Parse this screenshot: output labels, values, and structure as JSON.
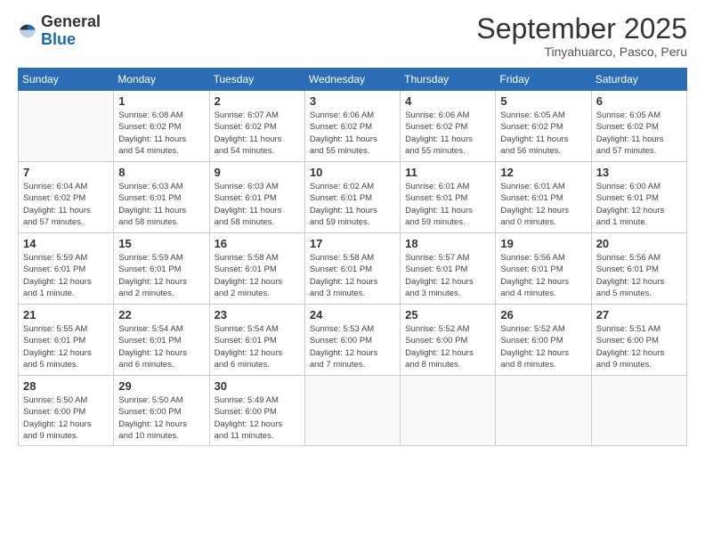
{
  "logo": {
    "general": "General",
    "blue": "Blue"
  },
  "header": {
    "month": "September 2025",
    "location": "Tinyahuarco, Pasco, Peru"
  },
  "days_of_week": [
    "Sunday",
    "Monday",
    "Tuesday",
    "Wednesday",
    "Thursday",
    "Friday",
    "Saturday"
  ],
  "weeks": [
    [
      {
        "day": "",
        "info": ""
      },
      {
        "day": "1",
        "info": "Sunrise: 6:08 AM\nSunset: 6:02 PM\nDaylight: 11 hours\nand 54 minutes."
      },
      {
        "day": "2",
        "info": "Sunrise: 6:07 AM\nSunset: 6:02 PM\nDaylight: 11 hours\nand 54 minutes."
      },
      {
        "day": "3",
        "info": "Sunrise: 6:06 AM\nSunset: 6:02 PM\nDaylight: 11 hours\nand 55 minutes."
      },
      {
        "day": "4",
        "info": "Sunrise: 6:06 AM\nSunset: 6:02 PM\nDaylight: 11 hours\nand 55 minutes."
      },
      {
        "day": "5",
        "info": "Sunrise: 6:05 AM\nSunset: 6:02 PM\nDaylight: 11 hours\nand 56 minutes."
      },
      {
        "day": "6",
        "info": "Sunrise: 6:05 AM\nSunset: 6:02 PM\nDaylight: 11 hours\nand 57 minutes."
      }
    ],
    [
      {
        "day": "7",
        "info": "Sunrise: 6:04 AM\nSunset: 6:02 PM\nDaylight: 11 hours\nand 57 minutes."
      },
      {
        "day": "8",
        "info": "Sunrise: 6:03 AM\nSunset: 6:01 PM\nDaylight: 11 hours\nand 58 minutes."
      },
      {
        "day": "9",
        "info": "Sunrise: 6:03 AM\nSunset: 6:01 PM\nDaylight: 11 hours\nand 58 minutes."
      },
      {
        "day": "10",
        "info": "Sunrise: 6:02 AM\nSunset: 6:01 PM\nDaylight: 11 hours\nand 59 minutes."
      },
      {
        "day": "11",
        "info": "Sunrise: 6:01 AM\nSunset: 6:01 PM\nDaylight: 11 hours\nand 59 minutes."
      },
      {
        "day": "12",
        "info": "Sunrise: 6:01 AM\nSunset: 6:01 PM\nDaylight: 12 hours\nand 0 minutes."
      },
      {
        "day": "13",
        "info": "Sunrise: 6:00 AM\nSunset: 6:01 PM\nDaylight: 12 hours\nand 1 minute."
      }
    ],
    [
      {
        "day": "14",
        "info": "Sunrise: 5:59 AM\nSunset: 6:01 PM\nDaylight: 12 hours\nand 1 minute."
      },
      {
        "day": "15",
        "info": "Sunrise: 5:59 AM\nSunset: 6:01 PM\nDaylight: 12 hours\nand 2 minutes."
      },
      {
        "day": "16",
        "info": "Sunrise: 5:58 AM\nSunset: 6:01 PM\nDaylight: 12 hours\nand 2 minutes."
      },
      {
        "day": "17",
        "info": "Sunrise: 5:58 AM\nSunset: 6:01 PM\nDaylight: 12 hours\nand 3 minutes."
      },
      {
        "day": "18",
        "info": "Sunrise: 5:57 AM\nSunset: 6:01 PM\nDaylight: 12 hours\nand 3 minutes."
      },
      {
        "day": "19",
        "info": "Sunrise: 5:56 AM\nSunset: 6:01 PM\nDaylight: 12 hours\nand 4 minutes."
      },
      {
        "day": "20",
        "info": "Sunrise: 5:56 AM\nSunset: 6:01 PM\nDaylight: 12 hours\nand 5 minutes."
      }
    ],
    [
      {
        "day": "21",
        "info": "Sunrise: 5:55 AM\nSunset: 6:01 PM\nDaylight: 12 hours\nand 5 minutes."
      },
      {
        "day": "22",
        "info": "Sunrise: 5:54 AM\nSunset: 6:01 PM\nDaylight: 12 hours\nand 6 minutes."
      },
      {
        "day": "23",
        "info": "Sunrise: 5:54 AM\nSunset: 6:01 PM\nDaylight: 12 hours\nand 6 minutes."
      },
      {
        "day": "24",
        "info": "Sunrise: 5:53 AM\nSunset: 6:00 PM\nDaylight: 12 hours\nand 7 minutes."
      },
      {
        "day": "25",
        "info": "Sunrise: 5:52 AM\nSunset: 6:00 PM\nDaylight: 12 hours\nand 8 minutes."
      },
      {
        "day": "26",
        "info": "Sunrise: 5:52 AM\nSunset: 6:00 PM\nDaylight: 12 hours\nand 8 minutes."
      },
      {
        "day": "27",
        "info": "Sunrise: 5:51 AM\nSunset: 6:00 PM\nDaylight: 12 hours\nand 9 minutes."
      }
    ],
    [
      {
        "day": "28",
        "info": "Sunrise: 5:50 AM\nSunset: 6:00 PM\nDaylight: 12 hours\nand 9 minutes."
      },
      {
        "day": "29",
        "info": "Sunrise: 5:50 AM\nSunset: 6:00 PM\nDaylight: 12 hours\nand 10 minutes."
      },
      {
        "day": "30",
        "info": "Sunrise: 5:49 AM\nSunset: 6:00 PM\nDaylight: 12 hours\nand 11 minutes."
      },
      {
        "day": "",
        "info": ""
      },
      {
        "day": "",
        "info": ""
      },
      {
        "day": "",
        "info": ""
      },
      {
        "day": "",
        "info": ""
      }
    ]
  ]
}
